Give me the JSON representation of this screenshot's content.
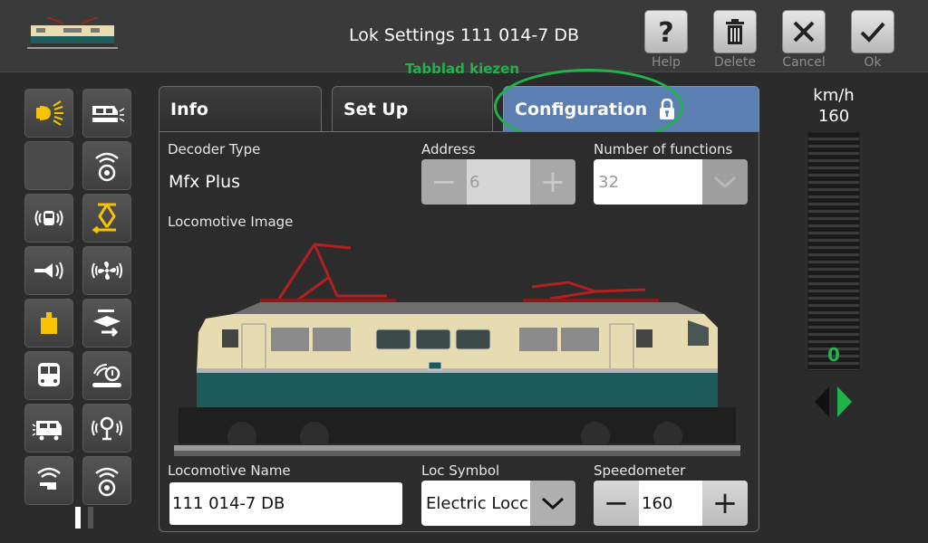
{
  "header": {
    "title": "Lok Settings 111 014-7 DB",
    "buttons": [
      {
        "id": "help",
        "label": "Help"
      },
      {
        "id": "delete",
        "label": "Delete"
      },
      {
        "id": "cancel",
        "label": "Cancel"
      },
      {
        "id": "ok",
        "label": "Ok"
      }
    ]
  },
  "hint": "Tabblad kiezen",
  "tabs": [
    {
      "label": "Info",
      "active": false
    },
    {
      "label": "Set Up",
      "active": false
    },
    {
      "label": "Configuration",
      "active": true,
      "icon": "lock-icon"
    }
  ],
  "config": {
    "decoder_type_label": "Decoder Type",
    "decoder_type_value": "Mfx Plus",
    "address_label": "Address",
    "address_value": "6",
    "functions_label": "Number of functions",
    "functions_value": "32",
    "image_label": "Locomotive Image",
    "name_label": "Locomotive Name",
    "name_value": "111 014-7 DB",
    "symbol_label": "Loc Symbol",
    "symbol_value": "Electric Locc",
    "speedometer_label": "Speedometer",
    "speedometer_value": "160"
  },
  "speed": {
    "unit": "km/h",
    "max": "160",
    "current": "0"
  },
  "functions": [
    "headlight-icon",
    "loco-light-icon",
    "empty",
    "sound-icon",
    "cab-sound-icon",
    "pantograph-icon",
    "horn-icon",
    "fan-sound-icon",
    "weight-icon",
    "shunting-icon",
    "tram-icon",
    "coupler-sound-icon",
    "loco-sound-icon",
    "brake-sound-icon",
    "whistle-sound-icon",
    "speaker-sound-icon"
  ],
  "colors": {
    "accent_green": "#22b24c",
    "tab_active": "#5a7fb0",
    "icon_yellow": "#f5c400"
  }
}
